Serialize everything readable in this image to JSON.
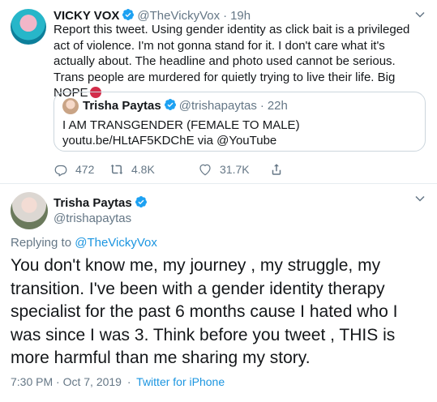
{
  "tweet1": {
    "name": "VICKY VOX",
    "handle": "@TheVickyVox",
    "time": "19h",
    "text": "Report this tweet. Using gender identity as click bait is a privileged act of violence. I'm not gonna stand for it. I don't care what it's actually about. The headline and photo used cannot be serious. Trans people are murdered for quietly trying to live their life. Big NOPE",
    "quoted": {
      "name": "Trisha Paytas",
      "handle": "@trishapaytas",
      "time": "22h",
      "text": "I AM TRANSGENDER (FEMALE TO MALE) youtu.be/HLtAF5KDChE via @YouTube"
    },
    "actions": {
      "replies": "472",
      "retweets": "4.8K",
      "likes": "31.7K"
    }
  },
  "tweet2": {
    "name": "Trisha Paytas",
    "handle": "@trishapaytas",
    "replying_prefix": "Replying to",
    "replying_to": "@TheVickyVox",
    "text": "You don't know me, my journey , my struggle, my transition. I've been with a gender identity therapy specialist for the past 6 months cause I hated who I was since I was 3. Think before you tweet , THIS is more harmful than me sharing my story.",
    "timestamp": "7:30 PM · Oct 7, 2019",
    "separator": "·",
    "client": "Twitter for iPhone"
  },
  "icons": {
    "verified": "verified-badge-icon",
    "chevron": "chevron-down-icon",
    "reply": "reply-icon",
    "retweet": "retweet-icon",
    "like": "heart-icon",
    "share": "share-icon",
    "emoji": "angry-face-icon"
  },
  "colors": {
    "text": "#14171a",
    "muted": "#657786",
    "link": "#1b95e0",
    "verified": "#1da1f2",
    "border": "#e6ecf0"
  }
}
